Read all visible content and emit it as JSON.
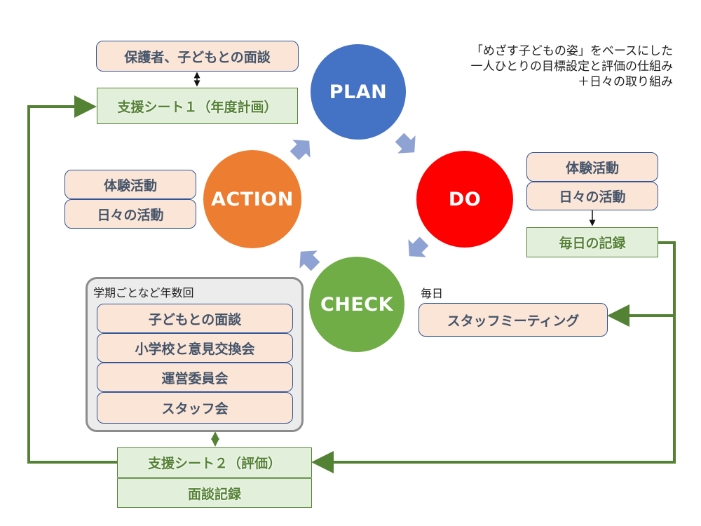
{
  "description": {
    "line1": "「めざす子どもの姿」をベースにした",
    "line2": "一人ひとりの目標設定と評価の仕組み",
    "line3": "＋日々の取り組み"
  },
  "cycle": {
    "plan": {
      "label": "PLAN",
      "color": "#4472c4"
    },
    "do": {
      "label": "DO",
      "color": "#ff0000"
    },
    "check": {
      "label": "CHECK",
      "color": "#70ad47"
    },
    "action": {
      "label": "ACTION",
      "color": "#ed7d31"
    },
    "arrow_color": "#8fa2d4"
  },
  "plan_side": {
    "interview": "保護者、子どもとの面談",
    "support_sheet_1": "支援シート１（年度計画）"
  },
  "do_side": {
    "items": [
      "体験活動",
      "日々の活動"
    ],
    "daily_record": "毎日の記録"
  },
  "action_side": {
    "items": [
      "体験活動",
      "日々の活動"
    ]
  },
  "check_side": {
    "daily_label": "毎日",
    "staff_meeting": "スタッフミーティング"
  },
  "periodic_group": {
    "title": "学期ごとなど年数回",
    "items": [
      "子どもとの面談",
      "小学校と意見交換会",
      "運営委員会",
      "スタッフ会"
    ]
  },
  "evaluation": {
    "support_sheet_2": "支援シート２（評価）",
    "interview_record": "面談記録"
  },
  "colors": {
    "connector_green": "#548235",
    "box_pink": "#fbe5d6",
    "box_green": "#e2efda",
    "box_border_blue": "#2f5597"
  }
}
